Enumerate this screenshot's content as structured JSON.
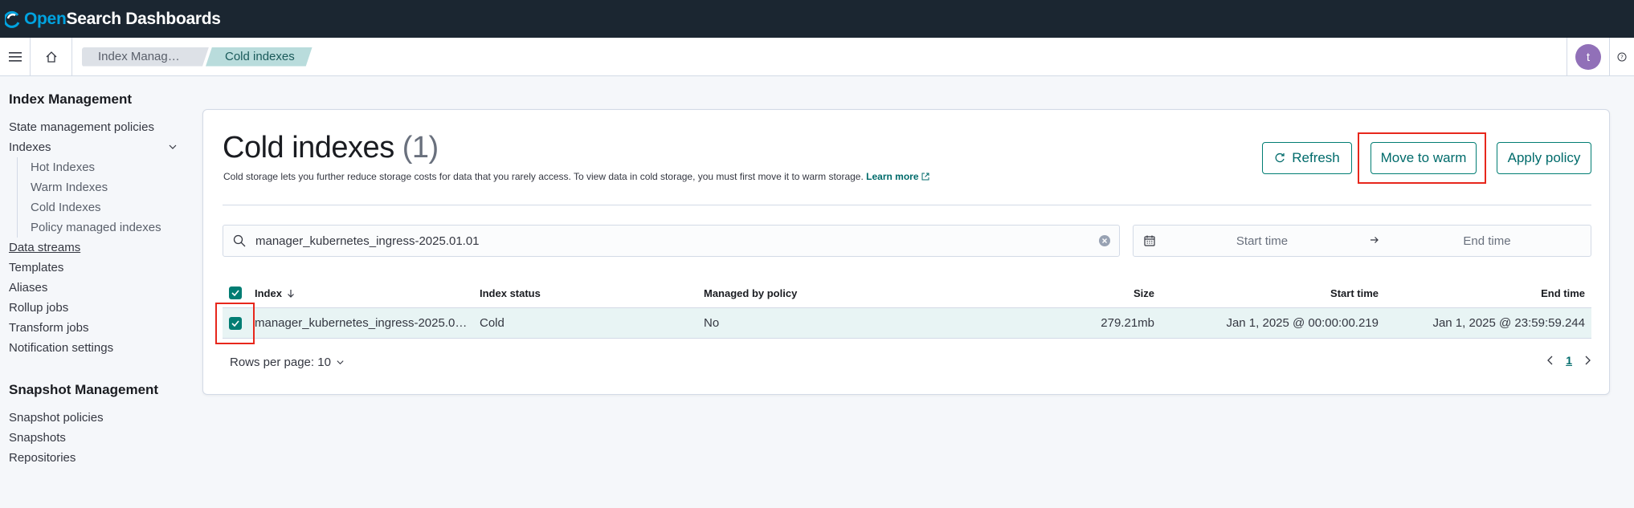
{
  "header": {
    "logo_open": "Open",
    "logo_rest": "Search Dashboards"
  },
  "breadcrumbs": [
    "Index Manage…",
    "Cold indexes"
  ],
  "user": {
    "initial": "t"
  },
  "sidebar": {
    "section1_title": "Index Management",
    "items": [
      "State management policies",
      "Indexes",
      "Hot Indexes",
      "Warm Indexes",
      "Cold Indexes",
      "Policy managed indexes",
      "Data streams",
      "Templates",
      "Aliases",
      "Rollup jobs",
      "Transform jobs",
      "Notification settings"
    ],
    "section2_title": "Snapshot Management",
    "items2": [
      "Snapshot policies",
      "Snapshots",
      "Repositories"
    ]
  },
  "main": {
    "title": "Cold indexes",
    "count": "(1)",
    "description": "Cold storage lets you further reduce storage costs for data that you rarely access. To view data in cold storage, you must first move it to warm storage.",
    "learn_more": "Learn more",
    "buttons": {
      "refresh": "Refresh",
      "move_to_warm": "Move to warm",
      "apply_policy": "Apply policy"
    },
    "search_value": "manager_kubernetes_ingress-2025.01.01",
    "date": {
      "start": "Start time",
      "end": "End time"
    },
    "table": {
      "columns": [
        "Index",
        "Index status",
        "Managed by policy",
        "Size",
        "Start time",
        "End time"
      ],
      "rows": [
        {
          "index": "manager_kubernetes_ingress-2025.0…",
          "status": "Cold",
          "managed": "No",
          "size": "279.21mb",
          "start": "Jan 1, 2025 @ 00:00:00.219",
          "end": "Jan 1, 2025 @ 23:59:59.244",
          "selected": true
        }
      ]
    },
    "rows_per_page": "Rows per page: 10",
    "current_page": "1"
  },
  "colors": {
    "accent": "#017d73",
    "header_bg": "#1b2631",
    "highlight": "#e7271c",
    "avatar": "#9170b8"
  }
}
